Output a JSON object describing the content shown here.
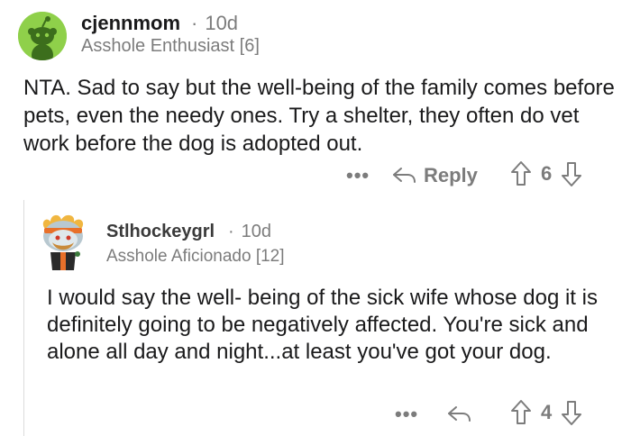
{
  "comments": [
    {
      "username": "cjennmom",
      "time": "10d",
      "flair": "Asshole Enthusiast [6]",
      "body": "NTA. Sad to say but the well-being of the family comes before pets, even the needy ones. Try a shelter, they often do vet work before the dog is adopted out.",
      "avatar": "snoo-avatar-green",
      "actions": {
        "more": "•••",
        "reply_label": "Reply",
        "vote_count": "6"
      }
    },
    {
      "username": "Stlhockeygrl",
      "time": "10d",
      "flair": "Asshole Aficionado [12]",
      "body": "I would say the well- being of the sick wife whose dog it is definitely going to be negatively affected. You're sick and alone all day and night...at least you've got your dog.",
      "avatar": "snoo-avatar-hockey",
      "actions": {
        "more": "•••",
        "vote_count": "4"
      }
    }
  ],
  "colors": {
    "text": "#1a1a1b",
    "meta": "#7c7c7c",
    "thread_line": "#dcdcdc",
    "avatar_green": "#8fd04a"
  },
  "icons": [
    "reply-arrow-icon",
    "upvote-arrow-icon",
    "downvote-arrow-icon"
  ]
}
